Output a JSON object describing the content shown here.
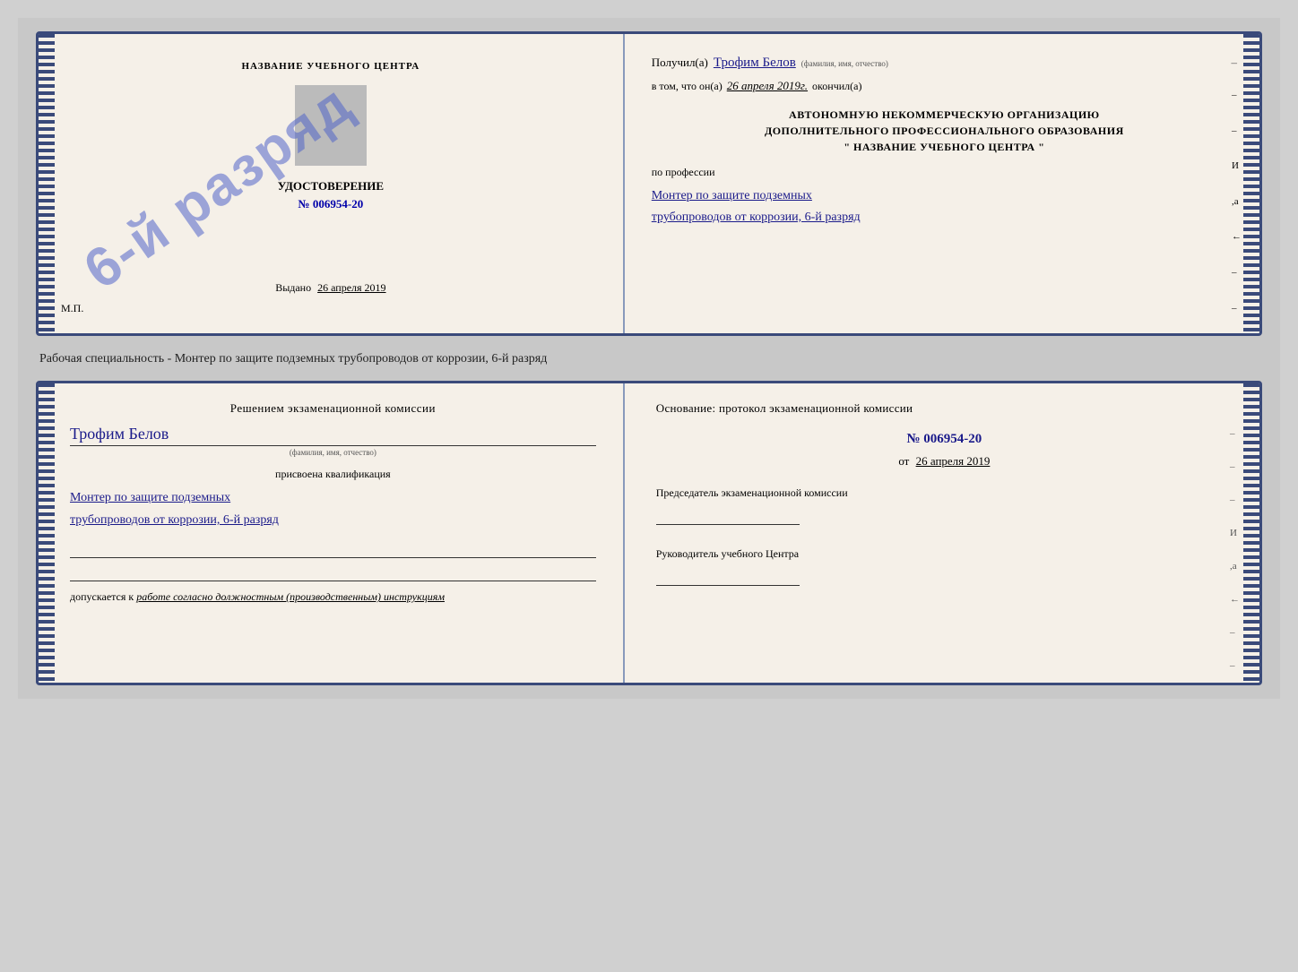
{
  "page": {
    "background_color": "#c8c8c8"
  },
  "top_cert": {
    "left": {
      "center_title": "НАЗВАНИЕ УЧЕБНОГО ЦЕНТРА",
      "udost_label": "УДОСТОВЕРЕНИЕ",
      "udost_number_prefix": "№",
      "udost_number": "006954-20",
      "stamp_text": "6-й разряд",
      "vydano_label": "Выдано",
      "vydano_date": "26 апреля 2019",
      "mp_label": "М.П."
    },
    "right": {
      "poluchil_label": "Получил(a)",
      "recipient_name": "Трофим Белов",
      "fio_sublabel": "(фамилия, имя, отчество)",
      "dash1": "–",
      "vtom_label": "в том, что он(а)",
      "date_completed": "26 апреля 2019г.",
      "okonchil_label": "окончил(a)",
      "org_line1": "АВТОНОМНУЮ НЕКОММЕРЧЕСКУЮ ОРГАНИЗАЦИЮ",
      "org_line2": "ДОПОЛНИТЕЛЬНОГО ПРОФЕССИОНАЛЬНОГО ОБРАЗОВАНИЯ",
      "org_quote_open": "\"",
      "org_name": "НАЗВАНИЕ УЧЕБНОГО ЦЕНТРА",
      "org_quote_close": "\"",
      "po_professii_label": "по профессии",
      "profession_line1": "Монтер по защите подземных",
      "profession_line2": "трубопроводов от коррозии, 6-й разряд",
      "side_labels": [
        "–",
        "–",
        "И",
        ",а",
        "←",
        "–",
        "–",
        "–"
      ]
    }
  },
  "middle_caption": "Рабочая специальность - Монтер по защите подземных трубопроводов от коррозии, 6-й разряд",
  "bottom_cert": {
    "left": {
      "resheniyem_text": "Решением  экзаменационной  комиссии",
      "fio": "Трофим Белов",
      "fio_sublabel": "(фамилия, имя, отчество)",
      "prisvoena_label": "присвоена квалификация",
      "qual_line1": "Монтер по защите подземных",
      "qual_line2": "трубопроводов от коррозии, 6-й разряд",
      "dopuskaetsya_label": "допускается к",
      "dopusk_italic": "работе согласно должностным (производственным) инструкциям"
    },
    "right": {
      "osnovanie_label": "Основание:  протокол  экзаменационной  комиссии",
      "protocol_number": "№  006954-20",
      "ot_prefix": "от",
      "ot_date": "26 апреля 2019",
      "predsedatel_label": "Председатель экзаменационной комиссии",
      "rukovoditel_label": "Руководитель учебного Центра",
      "side_labels": [
        "–",
        "–",
        "–",
        "И",
        ",а",
        "←",
        "–",
        "–",
        "–",
        "–"
      ]
    }
  }
}
